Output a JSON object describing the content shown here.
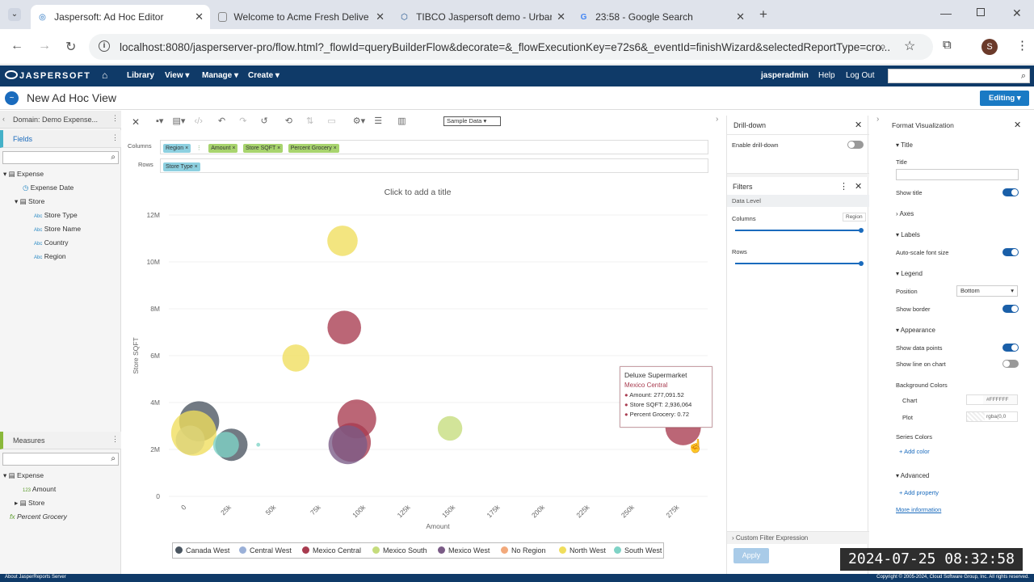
{
  "browser": {
    "tabs": [
      {
        "title": "Jaspersoft: Ad Hoc Editor",
        "active": true,
        "icon": "jaspersoft-icon"
      },
      {
        "title": "Welcome to Acme Fresh Delive",
        "active": false,
        "icon": "page-icon"
      },
      {
        "title": "TIBCO Jaspersoft demo - Urbar",
        "active": false,
        "icon": "tibco-icon"
      },
      {
        "title": "23:58 - Google Search",
        "active": false,
        "icon": "google-icon"
      }
    ],
    "url": "localhost:8080/jasperserver-pro/flow.html?_flowId=queryBuilderFlow&decorate=&_flowExecutionKey=e72s6&_eventId=finishWizard&selectedReportType=cro...",
    "profile_initial": "S"
  },
  "app": {
    "logo": "JASPERSOFT",
    "menu": [
      "Library",
      "View",
      "Manage",
      "Create"
    ],
    "user": "jasperadmin",
    "help": "Help",
    "logout": "Log Out",
    "view_title": "New Ad Hoc View",
    "editing_label": "Editing"
  },
  "left": {
    "domain_label": "Domain: Demo Expense...",
    "fields_header": "Fields",
    "fields_tree": [
      "Expense",
      "Expense Date",
      "Store",
      "Store Type",
      "Store Name",
      "Country",
      "Region"
    ],
    "measures_header": "Measures",
    "measures_tree": [
      "Expense",
      "Amount",
      "Store",
      "Percent Grocery"
    ]
  },
  "toolbar": {
    "sample_select": "Sample Data",
    "columns_label": "Columns",
    "rows_label": "Rows",
    "column_chips": [
      "Region",
      "Amount",
      "Store SQFT",
      "Percent Grocery"
    ],
    "row_chips": [
      "Store Type"
    ]
  },
  "chart_data": {
    "type": "scatter",
    "title_placeholder": "Click to add a title",
    "xlabel": "Amount",
    "ylabel": "Store SQFT",
    "x_ticks": [
      "0",
      "25k",
      "50k",
      "75k",
      "100k",
      "125k",
      "150k",
      "175k",
      "200k",
      "225k",
      "250k",
      "275k"
    ],
    "y_ticks": [
      "0",
      "2M",
      "4M",
      "6M",
      "8M",
      "10M",
      "12M"
    ],
    "xlim": [
      0,
      275000
    ],
    "ylim": [
      0,
      12000000
    ],
    "series": [
      {
        "name": "Canada West",
        "color": "#4a5560",
        "points": [
          {
            "x": 7000,
            "y": 3200000,
            "r": 0.62
          },
          {
            "x": 25000,
            "y": 2200000,
            "r": 0.5
          }
        ]
      },
      {
        "name": "Central West",
        "color": "#9ab0d8",
        "points": [
          {
            "x": 2000,
            "y": 2400000,
            "r": 0.45
          }
        ]
      },
      {
        "name": "Mexico Central",
        "color": "#a83b4f",
        "points": [
          {
            "x": 88000,
            "y": 7200000,
            "r": 0.52
          },
          {
            "x": 95000,
            "y": 3300000,
            "r": 0.6
          },
          {
            "x": 92000,
            "y": 2300000,
            "r": 0.6
          },
          {
            "x": 277091.52,
            "y": 2936064,
            "r": 0.55
          }
        ]
      },
      {
        "name": "Mexico South",
        "color": "#c5dc7c",
        "points": [
          {
            "x": 147000,
            "y": 2900000,
            "r": 0.38
          }
        ]
      },
      {
        "name": "Mexico West",
        "color": "#7a5b86",
        "points": [
          {
            "x": 90000,
            "y": 2200000,
            "r": 0.6
          }
        ]
      },
      {
        "name": "No Region",
        "color": "#f2a97b",
        "points": []
      },
      {
        "name": "North West",
        "color": "#f0de5c",
        "points": [
          {
            "x": 87000,
            "y": 10900000,
            "r": 0.47
          },
          {
            "x": 61000,
            "y": 5900000,
            "r": 0.42
          },
          {
            "x": 4000,
            "y": 2700000,
            "r": 0.7
          }
        ]
      },
      {
        "name": "South West",
        "color": "#7fd3c6",
        "points": [
          {
            "x": 22000,
            "y": 2200000,
            "r": 0.4
          },
          {
            "x": 40000,
            "y": 2200000,
            "r": 0.06
          }
        ]
      }
    ],
    "tooltip": {
      "title": "Deluxe Supermarket",
      "subtitle": "Mexico Central",
      "lines": [
        "Amount: 277,091.52",
        "Store SQFT: 2,936,064",
        "Percent Grocery: 0.72"
      ]
    },
    "legend_position": "bottom"
  },
  "drill": {
    "header": "Drill-down",
    "enable_label": "Enable drill-down",
    "filters_header": "Filters",
    "data_level": "Data Level",
    "columns_label": "Columns",
    "region_badge": "Region",
    "rows_label": "Rows",
    "custom_filter": "Custom Filter Expression",
    "apply": "Apply"
  },
  "format": {
    "header": "Format Visualization",
    "sections": {
      "title": "Title",
      "axes": "Axes",
      "labels": "Labels",
      "legend": "Legend",
      "appearance": "Appearance",
      "advanced": "Advanced"
    },
    "title_field_label": "Title",
    "show_title": "Show title",
    "auto_scale": "Auto-scale font size",
    "position_label": "Position",
    "position_value": "Bottom",
    "show_border": "Show border",
    "show_data_points": "Show data points",
    "show_line": "Show line on chart",
    "background_colors": "Background Colors",
    "chart_label": "Chart",
    "chart_color": "#FFFFFF",
    "plot_label": "Plot",
    "plot_color": "rgba(0,0",
    "series_colors": "Series Colors",
    "add_color": "Add color",
    "add_property": "Add property",
    "more_info": "More information"
  },
  "status": {
    "left": "About JasperReports Server",
    "right": "Copyright © 2005-2024, Cloud Software Group, Inc. All rights reserved."
  },
  "timestamp": "2024-07-25 08:32:58"
}
